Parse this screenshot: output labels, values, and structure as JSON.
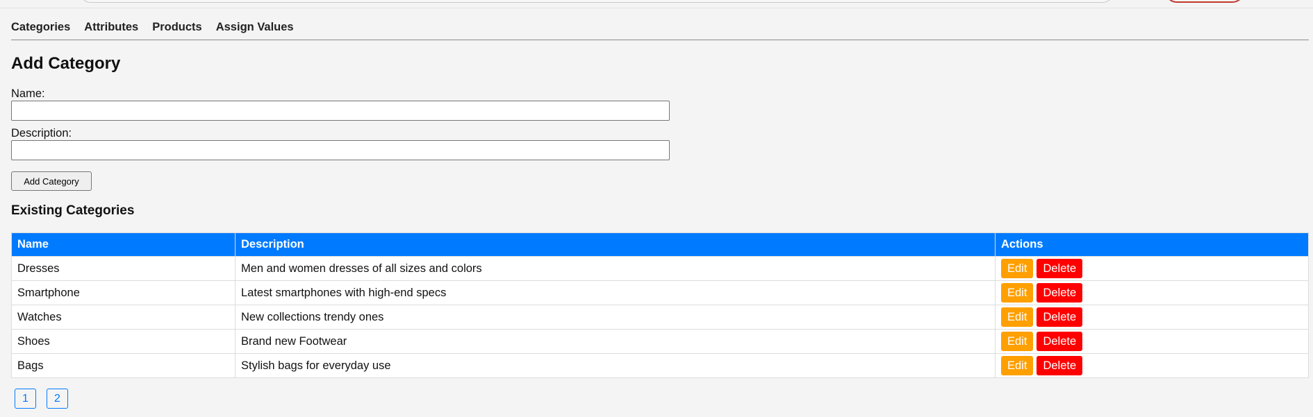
{
  "nav": {
    "items": [
      {
        "label": "Categories"
      },
      {
        "label": "Attributes"
      },
      {
        "label": "Products"
      },
      {
        "label": "Assign Values"
      }
    ]
  },
  "form": {
    "title": "Add Category",
    "name_label": "Name:",
    "name_value": "",
    "description_label": "Description:",
    "description_value": "",
    "submit_label": "Add Category"
  },
  "categories": {
    "title": "Existing Categories",
    "columns": [
      "Name",
      "Description",
      "Actions"
    ],
    "rows": [
      {
        "name": "Dresses",
        "description": "Men and women dresses of all sizes and colors"
      },
      {
        "name": "Smartphone",
        "description": "Latest smartphones with high-end specs"
      },
      {
        "name": "Watches",
        "description": "New collections trendy ones"
      },
      {
        "name": "Shoes",
        "description": "Brand new Footwear"
      },
      {
        "name": "Bags",
        "description": "Stylish bags for everyday use"
      }
    ],
    "edit_label": "Edit",
    "delete_label": "Delete"
  },
  "pagination": {
    "pages": [
      "1",
      "2"
    ]
  },
  "colors": {
    "header_blue": "#007bff",
    "edit_orange": "#ff9f00",
    "delete_red": "#ff0000"
  }
}
